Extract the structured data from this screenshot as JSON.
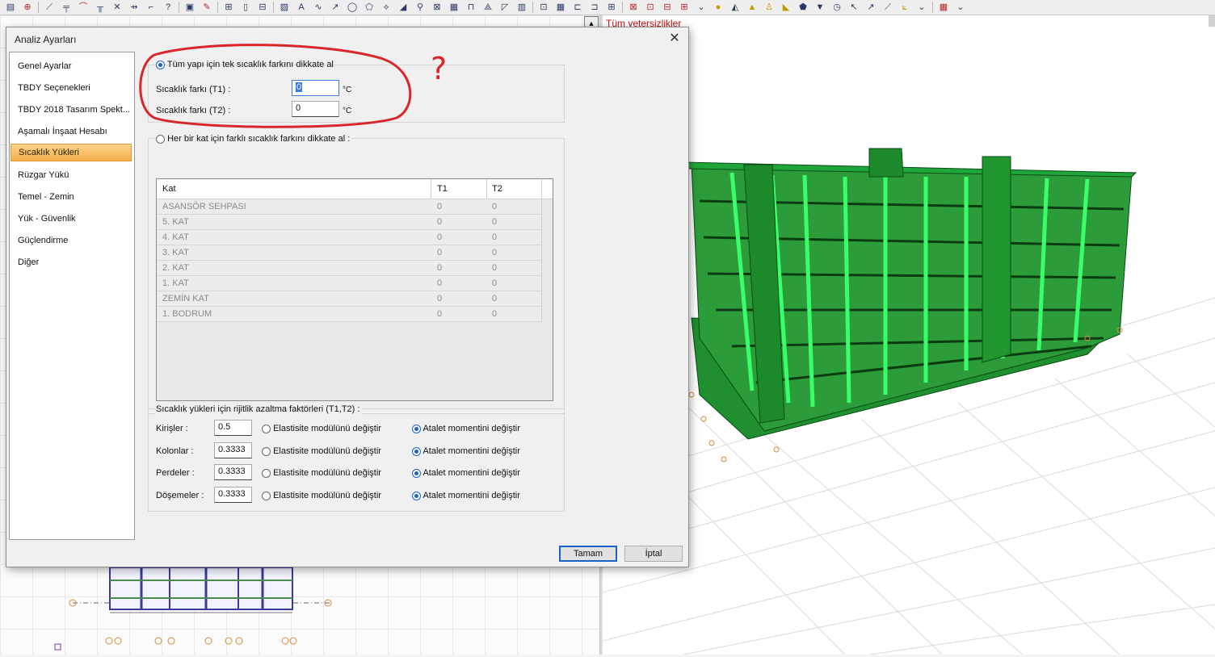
{
  "toolbar": {
    "icons": [
      "grid-icon",
      "target-icon",
      "draw-line-icon",
      "pipe-icon",
      "column-icon",
      "cross-icon",
      "move-icon",
      "rotate-icon",
      "frame-icon",
      "brush-icon",
      "grid2-icon",
      "node-icon",
      "image-icon",
      "text-icon",
      "wave-icon",
      "arc-icon",
      "circle-icon",
      "dim-icon",
      "stair-icon",
      "slab-icon",
      "truss-icon",
      "table-icon",
      "steel-icon",
      "beam-icon",
      "box-icon",
      "panel-icon",
      "axis-icon",
      "measure-icon",
      "tag-icon",
      "report-icon",
      "check-icon",
      "bulb-icon",
      "hat-icon",
      "triangle-icon",
      "marker-icon",
      "flag-icon",
      "pie-icon",
      "pointer-icon",
      "arrow-icon",
      "chart-icon",
      "chart2-icon",
      "print-icon",
      "more-icon"
    ]
  },
  "view3d": {
    "label": "Tüm yetersizlikler"
  },
  "dialog": {
    "title": "Analiz Ayarları",
    "close_symbol": "✕",
    "nav": [
      {
        "label": "Genel Ayarlar"
      },
      {
        "label": "TBDY Seçenekleri"
      },
      {
        "label": "TBDY 2018 Tasarım Spekt..."
      },
      {
        "label": "Aşamalı İnşaat Hesabı"
      },
      {
        "label": "Sıcaklık Yükleri",
        "selected": true
      },
      {
        "label": "Rüzgar Yükü"
      },
      {
        "label": "Temel - Zemin"
      },
      {
        "label": "Yük - Güvenlik"
      },
      {
        "label": "Güçlendirme"
      },
      {
        "label": "Diğer"
      }
    ],
    "whole_building": {
      "label": "Tüm yapı için tek sıcaklık farkını dikkate al",
      "selected": true,
      "t1_label": "Sıcaklık farkı  (T1) :",
      "t1_value": "0",
      "t2_label": "Sıcaklık farkı  (T2) :",
      "t2_value": "0",
      "unit": "°C"
    },
    "per_floor": {
      "label": "Her bir kat için farklı sıcaklık farkını dikkate al :",
      "selected": false,
      "columns": [
        "Kat",
        "T1",
        "T2"
      ],
      "rows": [
        [
          "ASANSÖR SEHPASI",
          "0",
          "0"
        ],
        [
          "5. KAT",
          "0",
          "0"
        ],
        [
          "4. KAT",
          "0",
          "0"
        ],
        [
          "3. KAT",
          "0",
          "0"
        ],
        [
          "2. KAT",
          "0",
          "0"
        ],
        [
          "1. KAT",
          "0",
          "0"
        ],
        [
          "ZEMİN KAT",
          "0",
          "0"
        ],
        [
          "1. BODRUM",
          "0",
          "0"
        ]
      ]
    },
    "stiffness": {
      "title": "Sıcaklık yükleri için rijitlik azaltma faktörleri (T1,T2) :",
      "option_elastic": "Elastisite modülünü değiştir",
      "option_inertia": "Atalet momentini değiştir",
      "rows": [
        {
          "label": "Kirişler :",
          "value": "0.5",
          "inertia": true
        },
        {
          "label": "Kolonlar :",
          "value": "0.3333",
          "inertia": true
        },
        {
          "label": "Perdeler :",
          "value": "0.3333",
          "inertia": true
        },
        {
          "label": "Döşemeler :",
          "value": "0.3333",
          "inertia": true
        }
      ]
    },
    "ok_label": "Tamam",
    "cancel_label": "İptal"
  },
  "annotation": {
    "text": "?",
    "color": "#d8262b"
  }
}
